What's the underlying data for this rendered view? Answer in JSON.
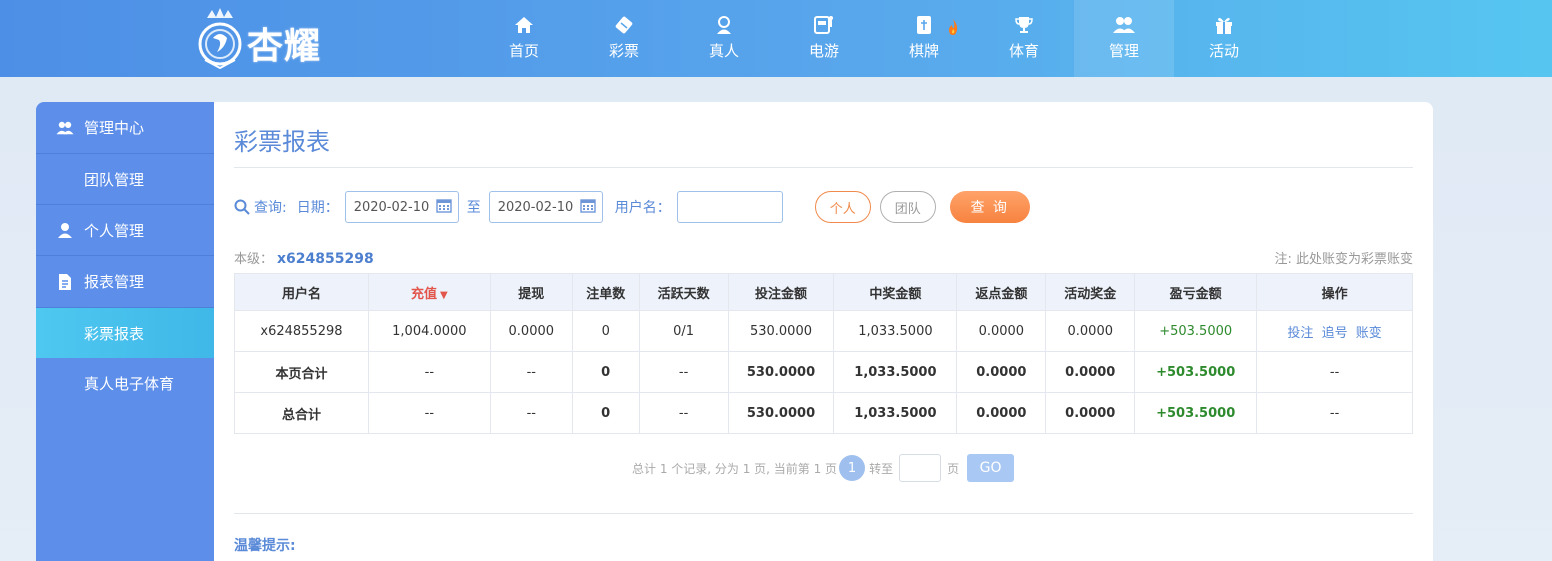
{
  "brand": {
    "name": "杏耀"
  },
  "nav": [
    {
      "label": "首页",
      "icon": "home-icon"
    },
    {
      "label": "彩票",
      "icon": "ticket-icon"
    },
    {
      "label": "真人",
      "icon": "person-icon"
    },
    {
      "label": "电游",
      "icon": "slot-machine-icon"
    },
    {
      "label": "棋牌",
      "icon": "cards-icon"
    },
    {
      "label": "体育",
      "icon": "trophy-icon"
    },
    {
      "label": "管理",
      "icon": "users-icon"
    },
    {
      "label": "活动",
      "icon": "gift-icon"
    }
  ],
  "sidebar": {
    "items": [
      {
        "label": "管理中心",
        "type": "group",
        "icon": "users-icon"
      },
      {
        "label": "团队管理",
        "type": "sub"
      },
      {
        "label": "个人管理",
        "type": "group",
        "icon": "user-icon"
      },
      {
        "label": "报表管理",
        "type": "group",
        "icon": "document-icon"
      },
      {
        "label": "彩票报表",
        "type": "sub",
        "active": true
      },
      {
        "label": "真人电子体育",
        "type": "sub"
      }
    ]
  },
  "page": {
    "title": "彩票报表"
  },
  "query": {
    "label": "查询:",
    "date_label": "日期：",
    "date_from": "2020-02-10",
    "to_label": "至",
    "date_to": "2020-02-10",
    "username_label": "用户名：",
    "username_value": "",
    "personal_label": "个人",
    "team_label": "团队",
    "search_label": "查 询"
  },
  "level": {
    "label": "本级：",
    "user": "x624855298"
  },
  "note": "注: 此处账变为彩票账变",
  "table": {
    "headers": [
      "用户名",
      "充值",
      "提现",
      "注单数",
      "活跃天数",
      "投注金额",
      "中奖金额",
      "返点金额",
      "活动奖金",
      "盈亏金额",
      "操作"
    ],
    "rows": [
      {
        "cells": [
          "x624855298",
          "1,004.0000",
          "0.0000",
          "0",
          "0/1",
          "530.0000",
          "1,033.5000",
          "0.0000",
          "0.0000",
          "+503.5000"
        ],
        "ops": [
          "投注",
          "追号",
          "账变"
        ]
      },
      {
        "cells": [
          "本页合计",
          "--",
          "--",
          "0",
          "--",
          "530.0000",
          "1,033.5000",
          "0.0000",
          "0.0000",
          "+503.5000",
          "--"
        ]
      },
      {
        "cells": [
          "总合计",
          "--",
          "--",
          "0",
          "--",
          "530.0000",
          "1,033.5000",
          "0.0000",
          "0.0000",
          "+503.5000",
          "--"
        ]
      }
    ]
  },
  "pager": {
    "summary": "总计 1 个记录, 分为 1 页, 当前第 1 页",
    "current": "1",
    "jump_label": "转至",
    "page_label": "页",
    "go_label": "GO"
  },
  "tips": {
    "title": "温馨提示:"
  },
  "colors": {
    "accent": "#5a8ad8",
    "sidebar": "#5c8eea",
    "active_sub": "#4ec8f0",
    "profit": "#2d8a2d",
    "query_btn": "#f7833f"
  }
}
